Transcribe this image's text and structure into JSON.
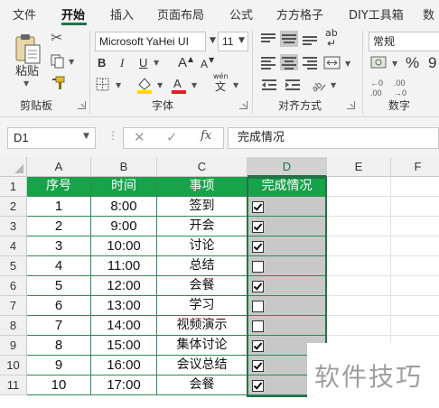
{
  "menu": {
    "tabs": [
      "文件",
      "开始",
      "插入",
      "页面布局",
      "公式",
      "方方格子",
      "DIY工具箱",
      "数"
    ],
    "active_tab": "开始"
  },
  "ribbon": {
    "clipboard": {
      "paste_label": "粘贴",
      "group_label": "剪贴板"
    },
    "font": {
      "font_name": "Microsoft YaHei UI",
      "font_size": "11",
      "bold": "B",
      "italic": "I",
      "underline": "U",
      "grow": "A",
      "shrink": "A",
      "wen_top": "wén",
      "wen_bottom": "文",
      "group_label": "字体",
      "fill_color": "#ffd800",
      "font_color": "#e02020"
    },
    "alignment": {
      "group_label": "对齐方式",
      "wrap_icon": "ab"
    },
    "number": {
      "format": "常规",
      "percent": "%",
      "comma": "9",
      "inc_dec_top": "←0",
      "inc_dec_top2": ".00",
      "dec_top": ".00",
      "dec_bottom": "→0",
      "group_label": "数字"
    }
  },
  "formula_bar": {
    "name_box": "D1",
    "fx": "fx",
    "content": "完成情况"
  },
  "sheet": {
    "columns": [
      "A",
      "B",
      "C",
      "D",
      "E",
      "F"
    ],
    "selected_column": "D",
    "row_numbers": [
      "1",
      "2",
      "3",
      "4",
      "5",
      "6",
      "7",
      "8",
      "9",
      "10",
      "11"
    ],
    "headers": [
      "序号",
      "时间",
      "事项",
      "完成情况"
    ],
    "rows": [
      {
        "no": "1",
        "time": "8:00",
        "item": "签到",
        "done": true
      },
      {
        "no": "2",
        "time": "9:00",
        "item": "开会",
        "done": true
      },
      {
        "no": "3",
        "time": "10:00",
        "item": "讨论",
        "done": true
      },
      {
        "no": "4",
        "time": "11:00",
        "item": "总结",
        "done": false
      },
      {
        "no": "5",
        "time": "12:00",
        "item": "会餐",
        "done": true
      },
      {
        "no": "6",
        "time": "13:00",
        "item": "学习",
        "done": false
      },
      {
        "no": "7",
        "time": "14:00",
        "item": "视频演示",
        "done": false
      },
      {
        "no": "8",
        "time": "15:00",
        "item": "集体讨论",
        "done": true
      },
      {
        "no": "9",
        "time": "16:00",
        "item": "会议总结",
        "done": true
      },
      {
        "no": "10",
        "time": "17:00",
        "item": "会餐",
        "done": true
      }
    ],
    "header_color": "#17a34a",
    "selection_color": "#217346"
  },
  "watermark": "软件技巧"
}
